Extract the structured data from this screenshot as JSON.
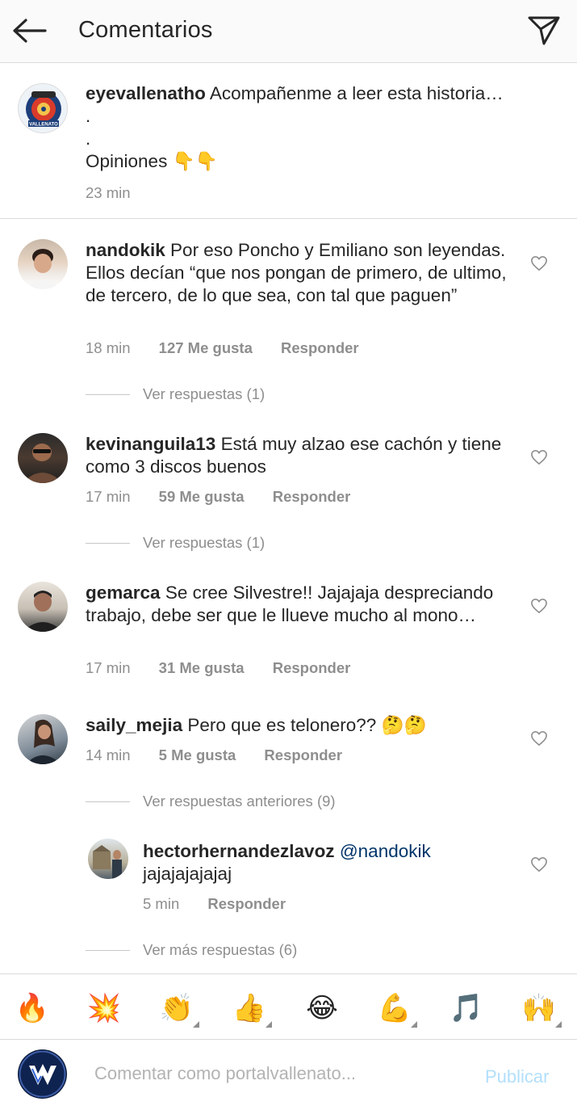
{
  "header": {
    "title": "Comentarios",
    "back_icon": "arrow-left-icon",
    "send_icon": "paper-plane-icon"
  },
  "caption": {
    "username": "eyevallenatho",
    "line1": "Acompañenme a leer esta historia…",
    "line2": ".",
    "line3": ".",
    "line4": "Opiniones 👇👇",
    "time": "23 min",
    "avatar_text": "VALLENATO"
  },
  "comments": [
    {
      "username": "nandokik",
      "text": "Por eso Poncho y Emiliano son leyendas. Ellos decían “que nos pongan de primero, de ultimo, de tercero, de lo que sea, con tal que paguen”",
      "time": "18 min",
      "likes": "127 Me gusta",
      "reply": "Responder",
      "view_replies": "Ver respuestas (1)"
    },
    {
      "username": "kevinanguila13",
      "text": "Está muy alzao ese cachón y tiene como 3 discos buenos",
      "time": "17 min",
      "likes": "59 Me gusta",
      "reply": "Responder",
      "view_replies": "Ver respuestas (1)"
    },
    {
      "username": "gemarca",
      "text": "Se cree Silvestre!! Jajajaja despreciando trabajo, debe ser que le llueve mucho al mono…",
      "time": "17 min",
      "likes": "31 Me gusta",
      "reply": "Responder"
    },
    {
      "username": "saily_mejia",
      "text": "Pero que es telonero?? 🤔🤔",
      "time": "14 min",
      "likes": "5 Me gusta",
      "reply": "Responder",
      "view_replies": "Ver respuestas anteriores (9)"
    }
  ],
  "nested_reply": {
    "username": "hectorhernandezlavoz",
    "mention": "@nandokik",
    "text": "jajajajajajaj",
    "time": "5 min",
    "reply": "Responder",
    "more_replies": "Ver más respuestas (6)"
  },
  "emojis": [
    "🔥",
    "💥",
    "👏",
    "👍",
    "😂",
    "💪",
    "🎵",
    "🙌"
  ],
  "composer": {
    "placeholder": "Comentar como portalvallenato...",
    "publish": "Publicar"
  },
  "colors": {
    "text": "#262626",
    "secondary": "#8e8e8e",
    "divider": "#dbdbdb",
    "publish_disabled": "#b2dffc",
    "mention": "#003569"
  }
}
